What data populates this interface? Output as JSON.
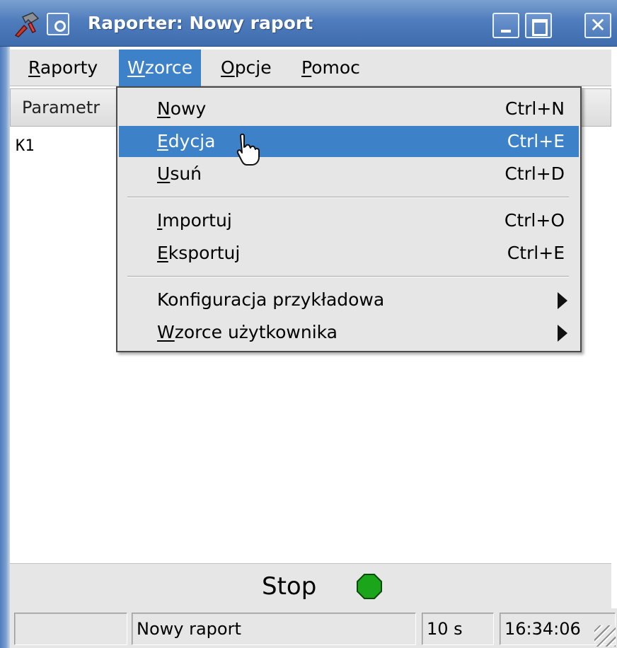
{
  "window": {
    "title": "Raporter: Nowy raport",
    "icon": "app-hammer-icon",
    "controls": [
      "minimize",
      "maximize",
      "close"
    ],
    "close_glyph": "✕"
  },
  "menubar": {
    "items": [
      {
        "pre": "",
        "ul": "R",
        "post": "aporty"
      },
      {
        "pre": "",
        "ul": "W",
        "post": "zorce"
      },
      {
        "pre": "",
        "ul": "O",
        "post": "pcje"
      },
      {
        "pre": "",
        "ul": "P",
        "post": "omoc"
      }
    ],
    "active_index": 1
  },
  "list": {
    "header": "Parametr",
    "rows": [
      "K1"
    ]
  },
  "dropdown": {
    "items": [
      {
        "pre": "",
        "ul": "N",
        "post": "owy",
        "shortcut": "Ctrl+N"
      },
      {
        "pre": "",
        "ul": "E",
        "post": "dycja",
        "shortcut": "Ctrl+E",
        "highlighted": true
      },
      {
        "pre": "",
        "ul": "U",
        "post": "suń",
        "shortcut": "Ctrl+D"
      },
      {
        "pre": "",
        "ul": "I",
        "post": "mportuj",
        "shortcut": "Ctrl+O"
      },
      {
        "pre": "",
        "ul": "E",
        "post": "ksportuj",
        "shortcut": "Ctrl+E"
      },
      {
        "label": "Konfiguracja przykładowa",
        "submenu": true
      },
      {
        "pre": "",
        "ul": "W",
        "post": "zorce użytkownika",
        "submenu": true
      }
    ]
  },
  "stop": {
    "label": "Stop",
    "indicator_color": "#1aa51a"
  },
  "statusbar": {
    "cell1": "",
    "cell2": "Nowy raport",
    "cell3": "10 s",
    "cell4": "16:34:06"
  },
  "colors": {
    "titlebar": "#4f7cbc",
    "selection": "#3d81c8",
    "menu_bg": "#e6e6e6"
  }
}
